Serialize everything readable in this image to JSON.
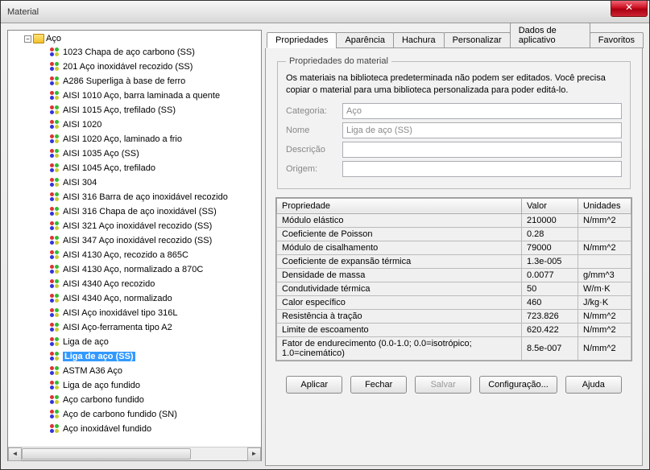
{
  "window": {
    "title": "Material"
  },
  "tree": {
    "root_label": "Aço",
    "selected_index": 19,
    "items": [
      {
        "label": "1023 Chapa de aço carbono (SS)"
      },
      {
        "label": "201 Aço inoxidável recozido (SS)"
      },
      {
        "label": "A286 Superliga à base de ferro"
      },
      {
        "label": "AISI 1010 Aço, barra laminada a quente"
      },
      {
        "label": "AISI 1015 Aço, trefilado (SS)"
      },
      {
        "label": "AISI 1020"
      },
      {
        "label": "AISI 1020 Aço, laminado a frio"
      },
      {
        "label": "AISI 1035 Aço (SS)"
      },
      {
        "label": "AISI 1045 Aço, trefilado"
      },
      {
        "label": "AISI 304"
      },
      {
        "label": "AISI 316 Barra de aço inoxidável recozido"
      },
      {
        "label": "AISI 316 Chapa de aço inoxidável (SS)"
      },
      {
        "label": "AISI 321 Aço inoxidável recozido (SS)"
      },
      {
        "label": "AISI 347 Aço inoxidável recozido (SS)"
      },
      {
        "label": "AISI 4130 Aço, recozido a 865C"
      },
      {
        "label": "AISI 4130 Aço, normalizado a 870C"
      },
      {
        "label": "AISI 4340 Aço recozido"
      },
      {
        "label": "AISI 4340 Aço, normalizado"
      },
      {
        "label": "AISI Aço inoxidável tipo 316L"
      },
      {
        "label": "AISI Aço-ferramenta tipo A2"
      },
      {
        "label": "Liga de aço"
      },
      {
        "label": "Liga de aço (SS)"
      },
      {
        "label": "ASTM A36 Aço"
      },
      {
        "label": "Liga de aço fundido"
      },
      {
        "label": "Aço carbono fundido"
      },
      {
        "label": "Aço de carbono fundido (SN)"
      },
      {
        "label": "Aço inoxidável fundido"
      }
    ]
  },
  "tabs": {
    "active": 0,
    "labels": [
      "Propriedades",
      "Aparência",
      "Hachura",
      "Personalizar",
      "Dados de aplicativo",
      "Favoritos"
    ]
  },
  "material_box": {
    "legend": "Propriedades do material",
    "note": "Os materiais na biblioteca predeterminada não podem ser editados. Você precisa copiar o material para uma biblioteca personalizada para poder editá-lo.",
    "labels": {
      "category": "Categoria:",
      "name": "Nome",
      "description": "Descrição",
      "source": "Origem:"
    },
    "values": {
      "category": "Aço",
      "name": "Liga de aço (SS)",
      "description": "",
      "source": ""
    }
  },
  "prop_table": {
    "headers": {
      "property": "Propriedade",
      "value": "Valor",
      "units": "Unidades"
    },
    "rows": [
      {
        "prop": "Módulo elástico",
        "val": "210000",
        "unit": "N/mm^2"
      },
      {
        "prop": "Coeficiente de Poisson",
        "val": "0.28",
        "unit": ""
      },
      {
        "prop": "Módulo de cisalhamento",
        "val": "79000",
        "unit": "N/mm^2"
      },
      {
        "prop": "Coeficiente de expansão térmica",
        "val": "1.3e-005",
        "unit": ""
      },
      {
        "prop": "Densidade de massa",
        "val": "0.0077",
        "unit": "g/mm^3"
      },
      {
        "prop": "Condutividade térmica",
        "val": "50",
        "unit": "W/m·K"
      },
      {
        "prop": "Calor específico",
        "val": "460",
        "unit": "J/kg·K"
      },
      {
        "prop": "Resistência à tração",
        "val": "723.826",
        "unit": "N/mm^2"
      },
      {
        "prop": "Limite de escoamento",
        "val": "620.422",
        "unit": "N/mm^2"
      },
      {
        "prop": "Fator de endurecimento (0.0-1.0; 0.0=isotrópico; 1.0=cinemático)",
        "val": "8.5e-007",
        "unit": "N/mm^2"
      }
    ]
  },
  "buttons": {
    "apply": "Aplicar",
    "close": "Fechar",
    "save": "Salvar",
    "config": "Configuração...",
    "help": "Ajuda"
  }
}
